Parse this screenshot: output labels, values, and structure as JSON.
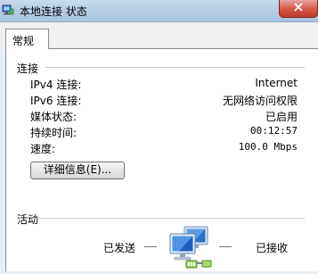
{
  "window": {
    "title": "本地连接 状态",
    "icon": "network-connection-icon",
    "close_icon": "close-icon"
  },
  "tabs": [
    {
      "label": "常规"
    }
  ],
  "connection": {
    "section_label": "连接",
    "rows": [
      {
        "label": "IPv4 连接:",
        "value": "Internet"
      },
      {
        "label": "IPv6 连接:",
        "value": "无网络访问权限"
      },
      {
        "label": "媒体状态:",
        "value": "已启用"
      },
      {
        "label": "持续时间:",
        "value": "00:12:57"
      },
      {
        "label": "速度:",
        "value": "100.0 Mbps"
      }
    ],
    "details_button": "详细信息(E)..."
  },
  "activity": {
    "section_label": "活动",
    "sent_label": "已发送",
    "received_label": "已接收",
    "icon": "network-computers-icon"
  },
  "colors": {
    "title_bar": "#b7cde6",
    "close_button": "#d65a4a",
    "panel_background": "#ffffff"
  }
}
